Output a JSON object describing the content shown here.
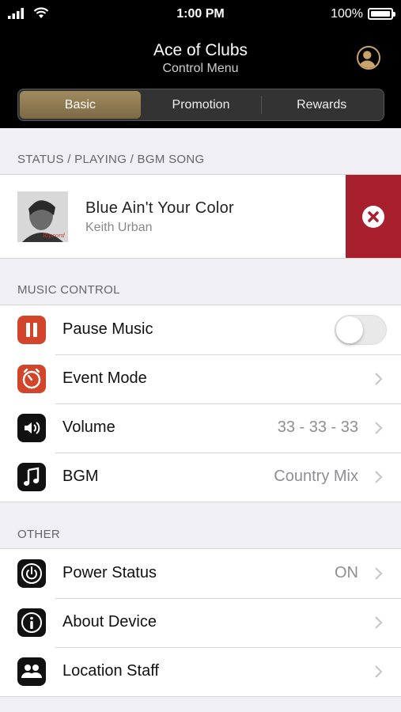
{
  "status_bar": {
    "time": "1:00 PM",
    "battery": "100%"
  },
  "header": {
    "title": "Ace of Clubs",
    "subtitle": "Control Menu"
  },
  "tabs": [
    {
      "label": "Basic",
      "active": true
    },
    {
      "label": "Promotion",
      "active": false
    },
    {
      "label": "Rewards",
      "active": false
    }
  ],
  "now_playing": {
    "section_label": "STATUS / PLAYING / BGM SONG",
    "song_title": "Blue Ain't Your Color",
    "artist": "Keith Urban"
  },
  "music_control": {
    "section_label": "MUSIC CONTROL",
    "items": [
      {
        "label": "Pause Music",
        "icon": "pause-icon",
        "toggle_on": false
      },
      {
        "label": "Event Mode",
        "icon": "timer-icon"
      },
      {
        "label": "Volume",
        "value": "33 - 33 - 33",
        "icon": "volume-icon"
      },
      {
        "label": "BGM",
        "value": "Country Mix",
        "icon": "music-note-icon"
      }
    ]
  },
  "other": {
    "section_label": "OTHER",
    "items": [
      {
        "label": "Power Status",
        "value": "ON",
        "icon": "power-icon"
      },
      {
        "label": "About Device",
        "icon": "info-icon"
      },
      {
        "label": "Location Staff",
        "icon": "people-icon"
      }
    ]
  },
  "colors": {
    "accent_gold": "#a18b5f",
    "stop_red": "#a8202d",
    "icon_red": "#d2452b"
  }
}
